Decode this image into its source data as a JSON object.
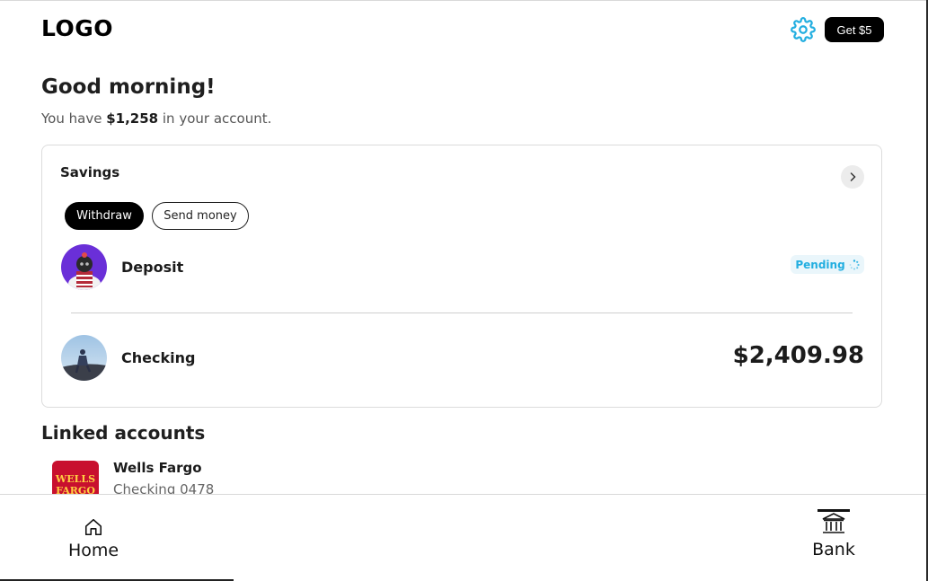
{
  "header": {
    "logo": "LOGO",
    "settings_icon": "gear-icon",
    "promo_button": "Get $5",
    "accent_color": "#22aee0"
  },
  "greeting": {
    "title": "Good morning!",
    "prefix": "You have",
    "amount": "$1,258",
    "suffix": "in your account."
  },
  "savings_card": {
    "title": "Savings",
    "chevron_icon": "chevron-right-icon",
    "actions": {
      "withdraw": "Withdraw",
      "send_money": "Send money"
    },
    "deposit": {
      "label": "Deposit",
      "status": "Pending",
      "status_icon": "spinner-icon"
    },
    "checking": {
      "label": "Checking",
      "amount": "$2,409.98"
    }
  },
  "linked_accounts": {
    "title": "Linked accounts",
    "items": [
      {
        "bank": "Wells Fargo",
        "logo_text": "WELLS FARGO",
        "account": "Checking 0478"
      }
    ]
  },
  "bottom_nav": {
    "home": {
      "label": "Home",
      "icon": "home-icon"
    },
    "bank": {
      "label": "Bank",
      "icon": "bank-icon",
      "active": true
    }
  }
}
